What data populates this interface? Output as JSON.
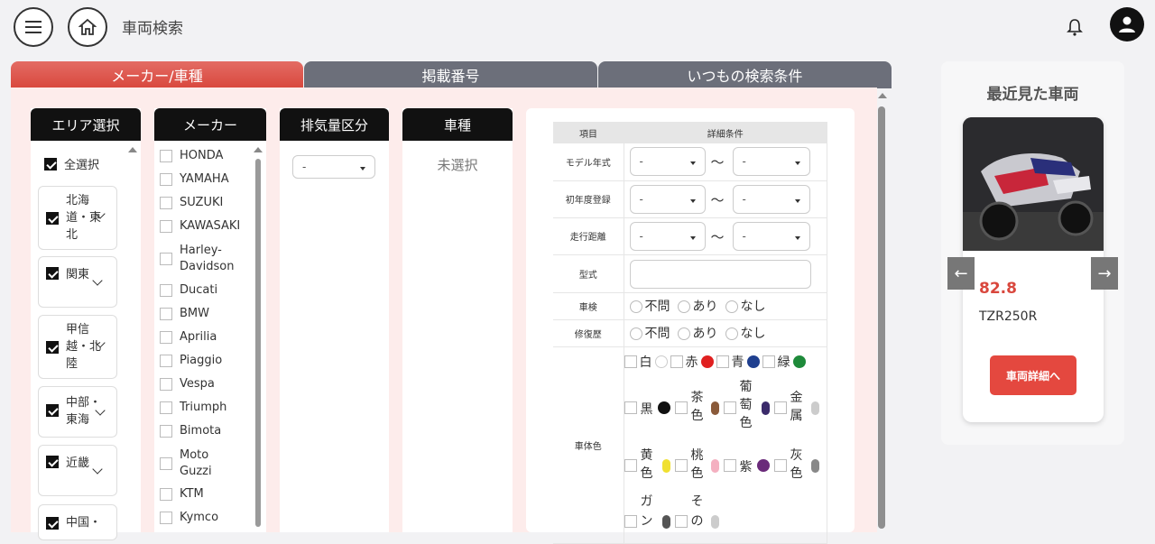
{
  "header": {
    "title": "車両検索"
  },
  "tabs": [
    {
      "label": "メーカー/車種"
    },
    {
      "label": "掲載番号"
    },
    {
      "label": "いつもの検索条件"
    }
  ],
  "area": {
    "header": "エリア選択",
    "select_all": "全選択",
    "items": [
      {
        "lines": [
          "北海",
          "道・東",
          "北"
        ]
      },
      {
        "lines": [
          "関東"
        ]
      },
      {
        "lines": [
          "甲信",
          "越・北",
          "陸"
        ]
      },
      {
        "lines": [
          "中部・",
          "東海"
        ]
      },
      {
        "lines": [
          "近畿"
        ]
      },
      {
        "lines": [
          "中国・"
        ]
      }
    ]
  },
  "maker": {
    "header": "メーカー",
    "items": [
      "HONDA",
      "YAMAHA",
      "SUZUKI",
      "KAWASAKI",
      "Harley-",
      "Davidson",
      "Ducati",
      "BMW",
      "Aprilia",
      "Piaggio",
      "Vespa",
      "Triumph",
      "Bimota",
      "Moto",
      "Guzzi",
      "KTM",
      "Kymco"
    ]
  },
  "displacement": {
    "header": "排気量区分",
    "select_value": "-"
  },
  "model_col": {
    "header": "車種",
    "empty_text": "未選択"
  },
  "details": {
    "col_item": "項目",
    "col_detail": "詳細条件",
    "rows": {
      "model_year": "モデル年式",
      "first_reg": "初年度登録",
      "mileage": "走行距離",
      "type": "型式",
      "inspection": "車検",
      "repair": "修復歴",
      "color": "車体色"
    },
    "range_sep": "〜",
    "dash": "-",
    "radio_options": [
      "不問",
      "あり",
      "なし"
    ],
    "colors": {
      "white": "白",
      "red": "赤",
      "blue": "青",
      "green": "緑",
      "black": "黒",
      "brown_1": "茶",
      "brown_2": "色",
      "grape_1": "葡",
      "grape_2": "萄",
      "grape_3": "色",
      "metal_1": "金",
      "metal_2": "属",
      "yellow_1": "黄",
      "yellow_2": "色",
      "pink_1": "桃",
      "pink_2": "色",
      "purple": "紫",
      "gray_1": "灰",
      "gray_2": "色",
      "gun_1": "ガ",
      "gun_2": "ン",
      "other_1": "そ",
      "other_2": "の"
    },
    "color_hex": {
      "red": "#e02020",
      "blue": "#1f3f8f",
      "green": "#1e8a3a",
      "black": "#111111",
      "brown": "#8a5a3a",
      "grape": "#3a2a6a",
      "metal": "#cccccc",
      "yellow": "#f0e030",
      "pink": "#f4b0c0",
      "purple": "#6a2a7a",
      "gray": "#888888",
      "gun": "#555555",
      "other": "#cccccc"
    }
  },
  "recent": {
    "title": "最近見た車両",
    "price": "82.8",
    "model": "TZR250R",
    "button": "車両詳細へ",
    "prev": "←",
    "next": "→"
  },
  "colors": {
    "accent": "#d9473d",
    "tab_inactive": "#6c6f7a",
    "panel_bg": "#fdeceb"
  }
}
